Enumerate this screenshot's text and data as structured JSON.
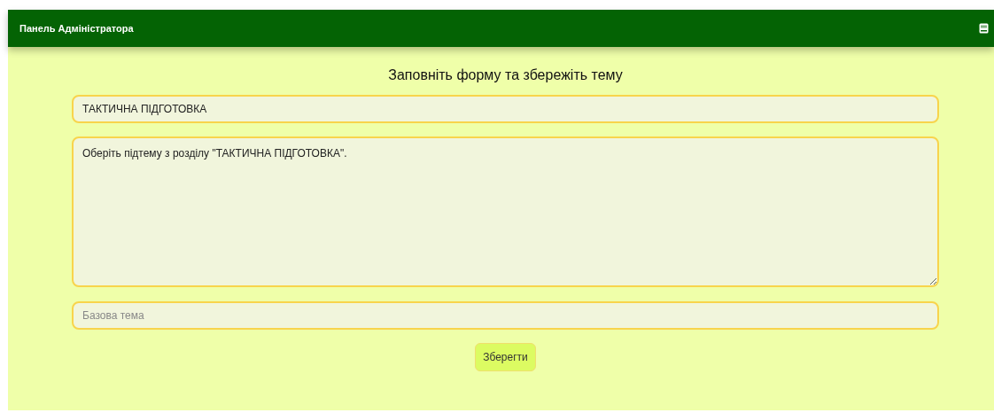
{
  "header": {
    "title": "Панель Адміністратора"
  },
  "form": {
    "heading": "Заповніть форму та збережіть тему",
    "title_field": {
      "value": "ТАКТИЧНА ПІДГОТОВКА"
    },
    "description_field": {
      "value": "Оберіть підтему з розділу \"ТАКТИЧНА ПІДГОТОВКА\"."
    },
    "base_topic_field": {
      "placeholder": "Базова тема"
    },
    "save_button": {
      "label": "Зберегти"
    }
  }
}
